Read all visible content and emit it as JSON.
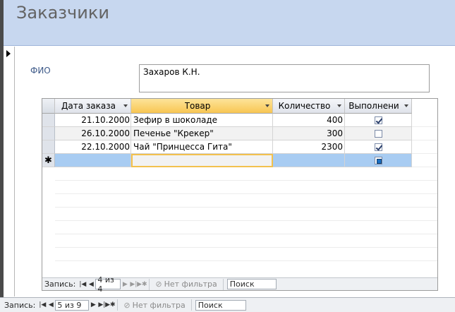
{
  "form": {
    "title": "Заказчики"
  },
  "customer": {
    "fio_label": "ФИО",
    "fio_value": "Захаров К.Н."
  },
  "subform": {
    "columns": [
      {
        "label": "Дата заказа"
      },
      {
        "label": "Товар"
      },
      {
        "label": "Количество"
      },
      {
        "label": "Выполнени"
      }
    ],
    "rows": [
      {
        "date": "21.10.2000",
        "product": "Зефир в шоколаде",
        "qty": "400",
        "done": true
      },
      {
        "date": "26.10.2000",
        "product": "Печенье \"Крекер\"",
        "qty": "300",
        "done": false
      },
      {
        "date": "22.10.2000",
        "product": "Чай \"Принцесса Гита\"",
        "qty": "2300",
        "done": true
      }
    ],
    "new_row_marker": "✱"
  },
  "subnav": {
    "label": "Запись:",
    "position": "4 из 4",
    "filter": "Нет фильтра",
    "search": "Поиск"
  },
  "mainnav": {
    "label": "Запись:",
    "position": "5 из 9",
    "filter": "Нет фильтра",
    "search": "Поиск"
  },
  "icons": {
    "first": "first-record-icon",
    "prev": "prev-record-icon",
    "next": "next-record-icon",
    "last": "last-record-icon",
    "new": "new-record-icon",
    "filter": "filter-icon"
  }
}
